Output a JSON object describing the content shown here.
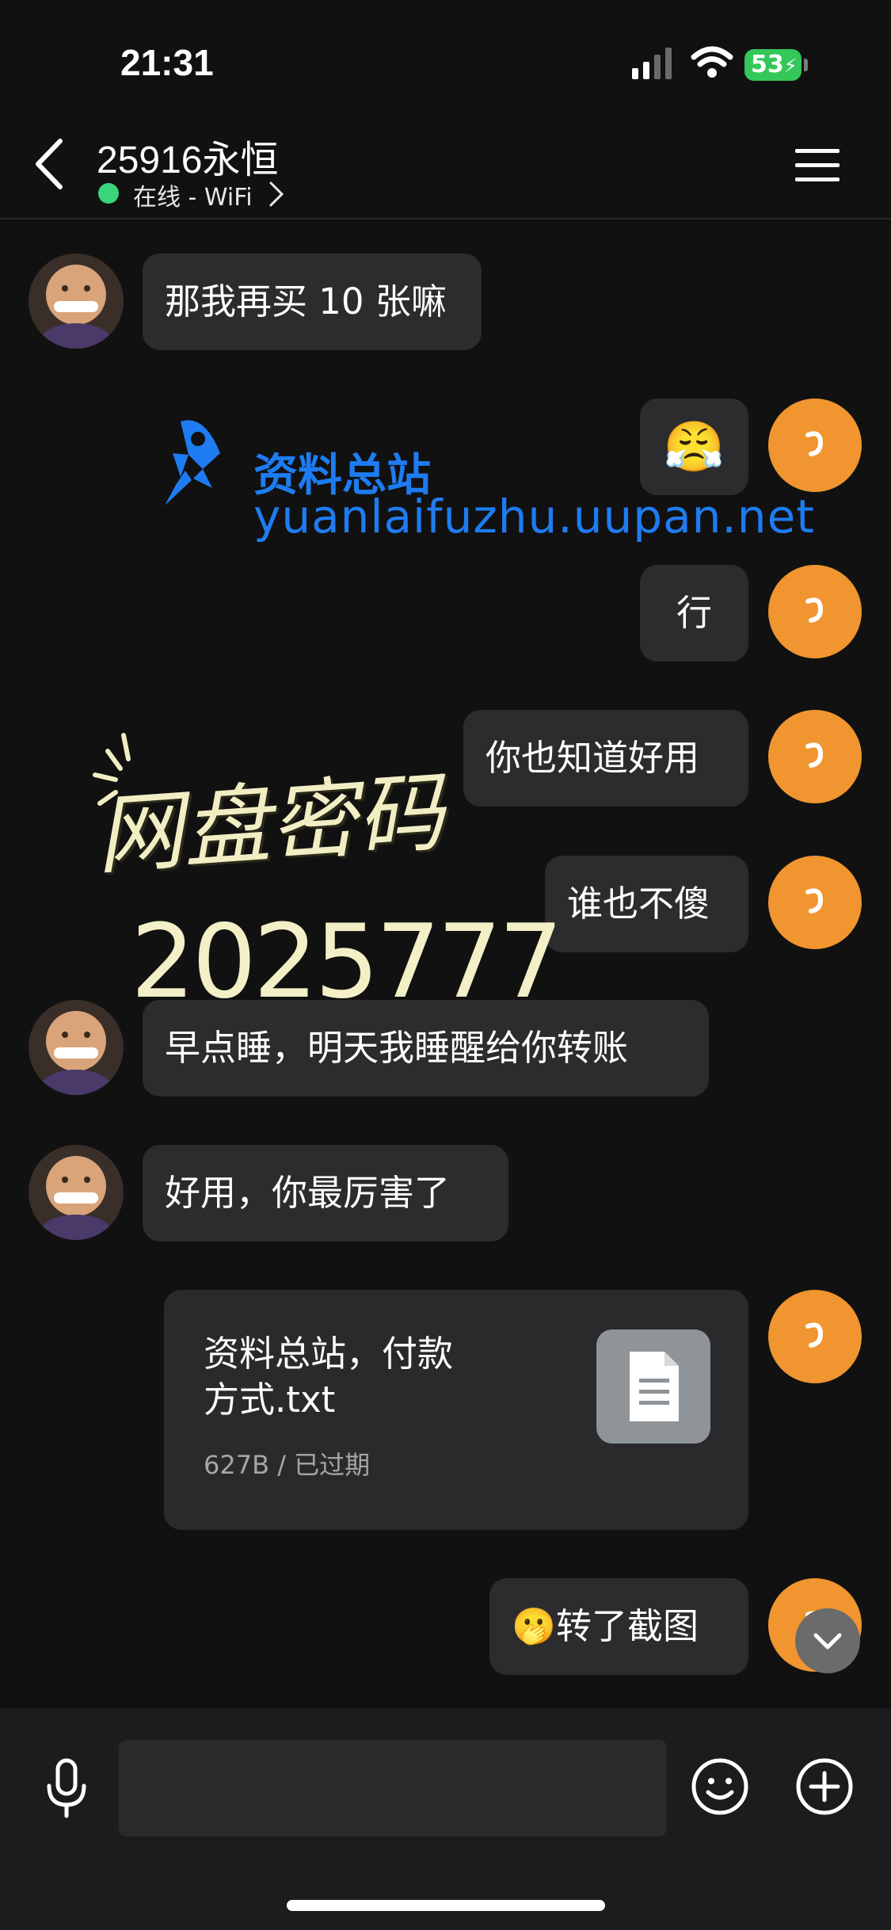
{
  "status_bar": {
    "time": "21:31",
    "battery": "53"
  },
  "header": {
    "contact_name": "25916永恒",
    "status": "在线 - WiFi"
  },
  "messages": [
    {
      "side": "left",
      "text": "那我再买 10 张嘛"
    },
    {
      "side": "right",
      "emoji": "😤"
    },
    {
      "side": "right",
      "text": "行"
    },
    {
      "side": "right",
      "text": "你也知道好用"
    },
    {
      "side": "right",
      "text": "谁也不傻"
    },
    {
      "side": "left",
      "text": "早点睡，明天我睡醒给你转账"
    },
    {
      "side": "left",
      "text": "好用，你最厉害了"
    },
    {
      "side": "right",
      "type": "file",
      "file_name": "资料总站，付款\n方式.txt",
      "file_meta": "627B / 已过期"
    },
    {
      "side": "right",
      "text": "🫢转了截图"
    }
  ],
  "watermark": {
    "brand": "资料总站",
    "url": "yuanlaifuzhu.uupan.net",
    "password_label": "网盘密码",
    "password_value": "2025777"
  },
  "input": {
    "placeholder": ""
  },
  "colors": {
    "accent_avatar": "#f0952f",
    "online": "#3ad47a",
    "bubble": "#2c2c2e",
    "watermark_blue": "#1e7cf2",
    "battery": "#34c759"
  },
  "icons": [
    "back-icon",
    "menu-icon",
    "mic-icon",
    "emoji-icon",
    "plus-icon",
    "file-icon",
    "chevron-down-icon",
    "wifi-icon",
    "signal-icon"
  ]
}
